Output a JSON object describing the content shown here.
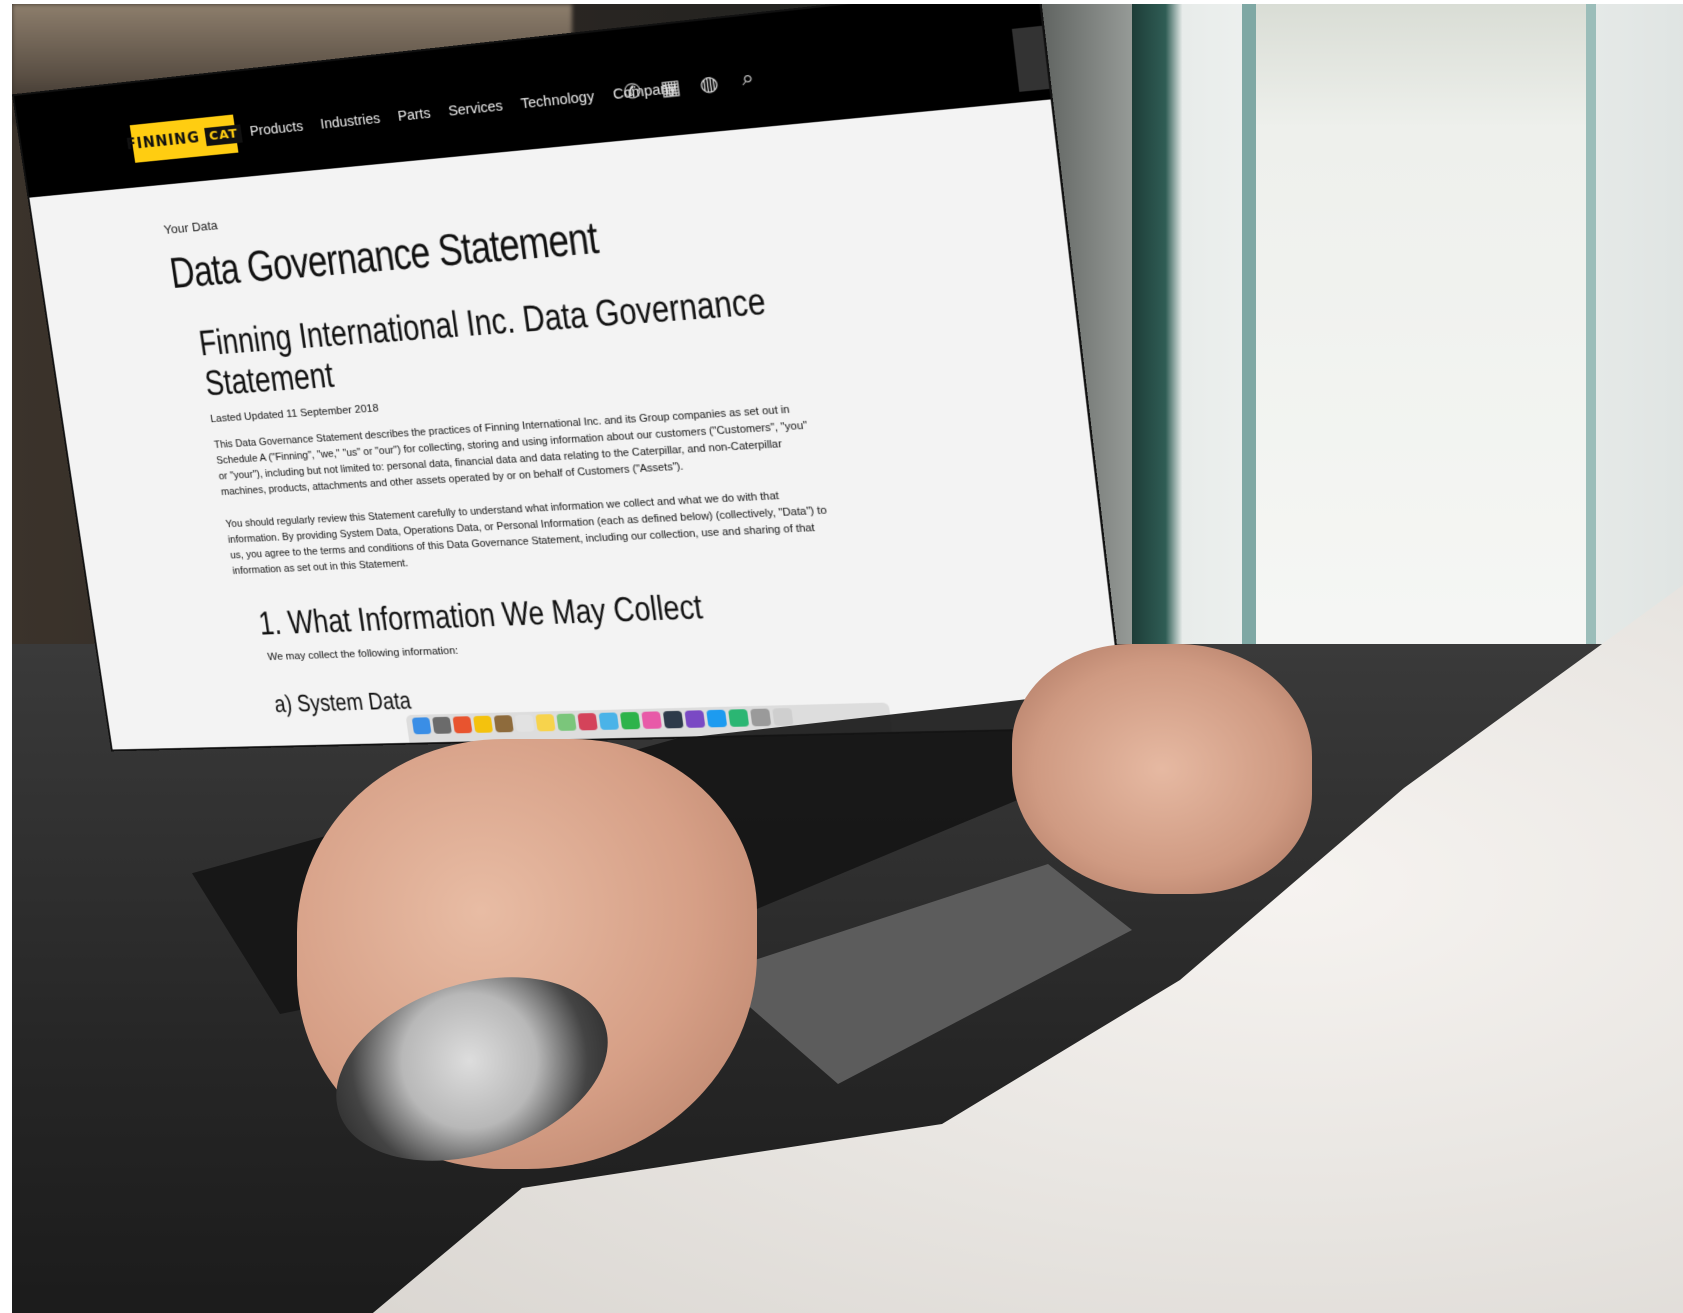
{
  "site": {
    "logo": {
      "text": "FINNING",
      "badge": "CAT"
    },
    "nav": [
      "Products",
      "Industries",
      "Parts",
      "Services",
      "Technology",
      "Company"
    ],
    "icons": [
      "phone-icon",
      "grid-icon",
      "globe-icon",
      "search-icon"
    ]
  },
  "page": {
    "breadcrumb": "Your Data",
    "title": "Data Governance Statement",
    "section_title": "Finning International Inc. Data Governance Statement",
    "updated": "Lasted Updated 11 September 2018",
    "para1": "This Data Governance Statement describes the practices of Finning International Inc. and its Group companies as set out in Schedule A (\"Finning\", \"we,\" \"us\" or \"our\") for collecting, storing and using information about our customers (\"Customers\", \"you\" or \"your\"), including but not limited to: personal data, financial data and data relating to the Caterpillar, and non-Caterpillar machines, products, attachments and other assets operated by or on behalf of Customers (\"Assets\").",
    "para2": "You should regularly review this Statement carefully to understand what information we collect and what we do with that information. By providing System Data, Operations Data, or Personal Information (each as defined below) (collectively, \"Data\") to us, you agree to the terms and conditions of this Data Governance Statement, including our collection, use and sharing of that information as set out in this Statement.",
    "h1": "1. What Information We May Collect",
    "collect": "We may collect the following information:",
    "sub": "a) System Data"
  },
  "colors": {
    "brand_yellow": "#ffcd11",
    "nav_bg": "#000000",
    "page_bg": "#f3f3f3"
  }
}
